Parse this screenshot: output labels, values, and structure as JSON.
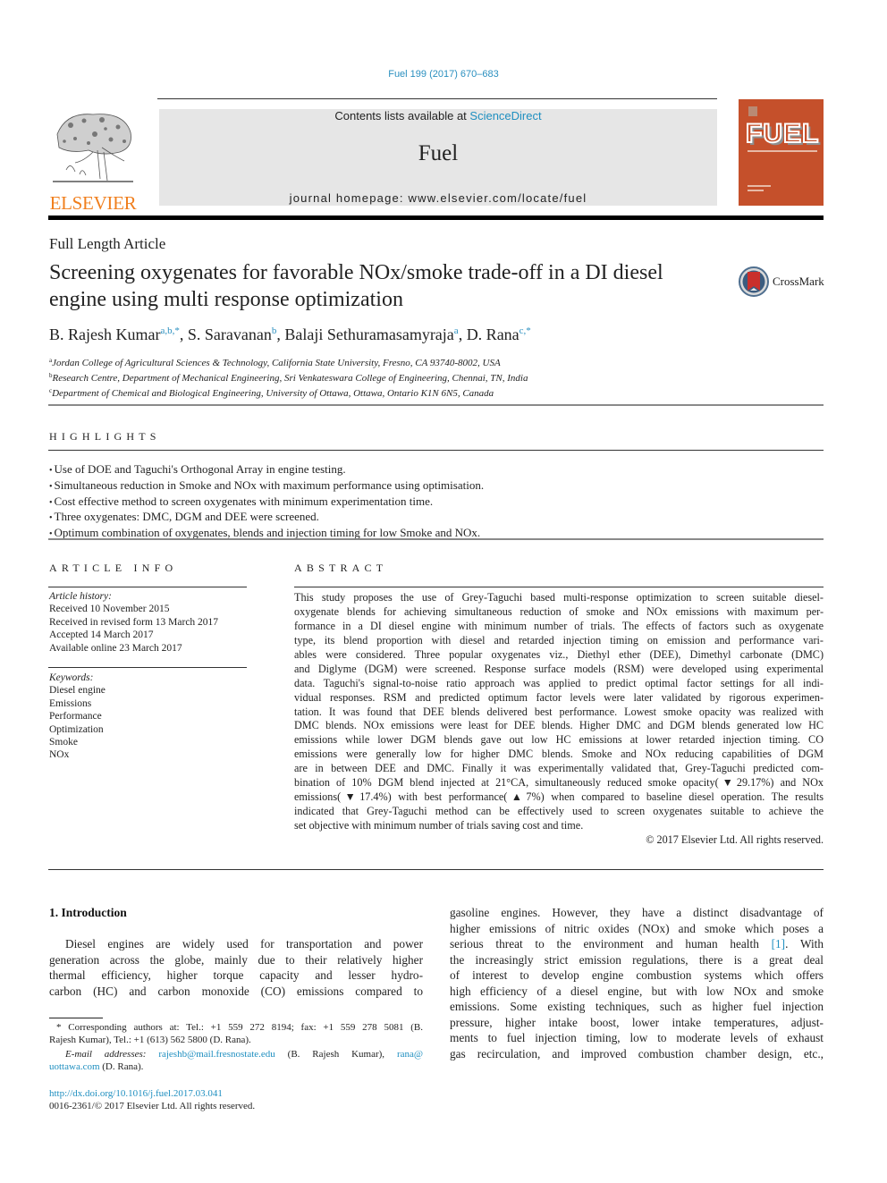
{
  "header": {
    "journal_reference": "Fuel 199 (2017) 670–683",
    "publisher_logo_text": "ELSEVIER",
    "contents_prefix": "Contents lists available at ",
    "contents_link": "ScienceDirect",
    "journal_title": "Fuel",
    "homepage": "journal homepage: www.elsevier.com/locate/fuel",
    "cover_title": "FUEL"
  },
  "article": {
    "type": "Full Length Article",
    "title_lines": [
      "Screening oxygenates for favorable NOx/smoke trade-off in a DI diesel",
      "engine using multi response optimization"
    ],
    "crossmark_label": "CrossMark",
    "authors": [
      {
        "name": "B. Rajesh Kumar",
        "sup": "a,b,*",
        "sep": ", "
      },
      {
        "name": "S. Saravanan",
        "sup": "b",
        "sep": ", "
      },
      {
        "name": "Balaji Sethuramasamyraja",
        "sup": "a",
        "sep": ", "
      },
      {
        "name": "D. Rana",
        "sup": "c,*",
        "sep": ""
      }
    ],
    "affiliations": [
      {
        "key": "a",
        "text": "Jordan College of Agricultural Sciences & Technology, California State University, Fresno, CA 93740-8002, USA"
      },
      {
        "key": "b",
        "text": "Research Centre, Department of Mechanical Engineering, Sri Venkateswara College of Engineering, Chennai, TN, India"
      },
      {
        "key": "c",
        "text": "Department of Chemical and Biological Engineering, University of Ottawa, Ottawa, Ontario K1N 6N5, Canada"
      }
    ]
  },
  "highlights": {
    "heading": "HIGHLIGHTS",
    "items": [
      "Use of DOE and Taguchi's Orthogonal Array in engine testing.",
      "Simultaneous reduction in Smoke and NOx with maximum performance using optimisation.",
      "Cost effective method to screen oxygenates with minimum experimentation time.",
      "Three oxygenates: DMC, DGM and DEE were screened.",
      "Optimum combination of oxygenates, blends and injection timing for low Smoke and NOx."
    ]
  },
  "article_info": {
    "heading": "ARTICLE INFO",
    "history_label": "Article history:",
    "history": [
      "Received 10 November 2015",
      "Received in revised form 13 March 2017",
      "Accepted 14 March 2017",
      "Available online 23 March 2017"
    ],
    "keywords_label": "Keywords:",
    "keywords": [
      "Diesel engine",
      "Emissions",
      "Performance",
      "Optimization",
      "Smoke",
      "NOx"
    ]
  },
  "abstract": {
    "heading": "ABSTRACT",
    "lines": [
      "This study proposes the use of Grey-Taguchi based multi-response optimization to screen suitable diesel-",
      "oxygenate blends for achieving simultaneous reduction of smoke and NOx emissions with maximum per-",
      "formance in a DI diesel engine with minimum number of trials. The effects of factors such as oxygenate",
      "type, its blend proportion with diesel and retarded injection timing on emission and performance vari-",
      "ables were considered. Three popular oxygenates viz., Diethyl ether (DEE), Dimethyl carbonate (DMC)",
      "and Diglyme (DGM) were screened. Response surface models (RSM) were developed using experimental",
      "data. Taguchi's signal-to-noise ratio approach was applied to predict optimal factor settings for all indi-",
      "vidual responses. RSM and predicted optimum factor levels were later validated by rigorous experimen-",
      "tation. It was found that DEE blends delivered best performance. Lowest smoke opacity was realized with",
      "DMC blends. NOx emissions were least for DEE blends. Higher DMC and DGM blends generated low HC",
      "emissions while lower DGM blends gave out low HC emissions at lower retarded injection timing. CO",
      "emissions were generally low for higher DMC blends. Smoke and NOx reducing capabilities of DGM",
      "are in between DEE and DMC. Finally it was experimentally validated that, Grey-Taguchi predicted com-",
      "bination of 10% DGM blend injected at 21°CA, simultaneously reduced smoke opacity(▼29.17%) and NOx",
      "emissions(▼17.4%) with best performance(▲7%) when compared to baseline diesel operation. The results",
      "indicated that Grey-Taguchi method can be effectively used to screen oxygenates suitable to achieve the",
      "set objective with minimum number of trials saving cost and time."
    ],
    "copyright": "© 2017 Elsevier Ltd. All rights reserved."
  },
  "introduction": {
    "heading": "1. Introduction",
    "left_lines": [
      "Diesel engines are widely used for transportation and power",
      "generation across the globe, mainly due to their relatively higher",
      "thermal efficiency, higher torque capacity and lesser hydro-",
      "carbon (HC) and carbon monoxide (CO) emissions compared to"
    ],
    "right_lines": [
      "gasoline engines. However, they have a distinct disadvantage of",
      "higher emissions of nitric oxides (NOx) and smoke which poses a",
      "serious threat to the environment and human health ",
      "the increasingly strict emission regulations, there is a great deal",
      "of interest to develop engine combustion systems which offers",
      "high efficiency of a diesel engine, but with low NOx and smoke",
      "emissions. Some existing techniques, such as higher fuel injection",
      "pressure, higher intake boost, lower intake temperatures, adjust-",
      "ments to fuel injection timing, low to moderate levels of exhaust",
      "gas recirculation, and improved combustion chamber design, etc.,"
    ],
    "citation": "[1]",
    "after_citation": ". With"
  },
  "footnotes": {
    "corresponding_line1": "* Corresponding authors at: Tel.: +1 559 272 8194; fax: +1 559 278 5081 (B.",
    "corresponding_line2": "Rajesh Kumar), Tel.: +1 (613) 562 5800 (D. Rana).",
    "email_label": "E-mail addresses:",
    "email1": "rajeshb@mail.fresnostate.edu",
    "email1_owner": " (B. Rajesh Kumar), ",
    "email2_part1": "rana@",
    "email2_part2": "uottawa.com",
    "email2_owner": " (D. Rana)."
  },
  "doi": {
    "link": "http://dx.doi.org/10.1016/j.fuel.2017.03.041",
    "issn_line": "0016-2361/© 2017 Elsevier Ltd. All rights reserved."
  }
}
